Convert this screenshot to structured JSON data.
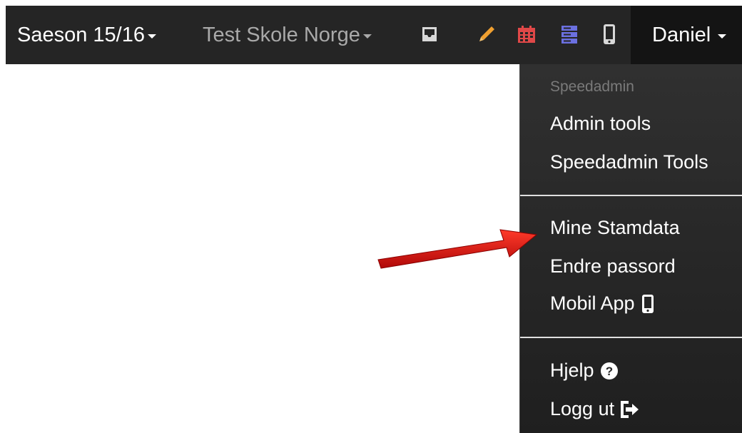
{
  "navbar": {
    "season_label": "Saeson 15/16",
    "school_label": "Test Skole Norge",
    "user_label": "Daniel",
    "icons": [
      "inbox-icon",
      "pencil-icon",
      "calendar-icon",
      "server-icon",
      "mobile-icon"
    ]
  },
  "dropdown": {
    "header": "Speedadmin",
    "items": [
      {
        "label": "Admin tools"
      },
      {
        "label": "Speedadmin Tools"
      },
      {
        "label": "Mine Stamdata"
      },
      {
        "label": "Endre passord"
      },
      {
        "label": "Mobil App"
      },
      {
        "label": "Hjelp"
      },
      {
        "label": "Logg ut"
      }
    ]
  },
  "colors": {
    "navbar_bg": "#252525",
    "user_bg": "#141414",
    "pencil": "#f0a030",
    "calendar": "#e04848",
    "server": "#6b70e0",
    "arrow": "#d81010"
  }
}
